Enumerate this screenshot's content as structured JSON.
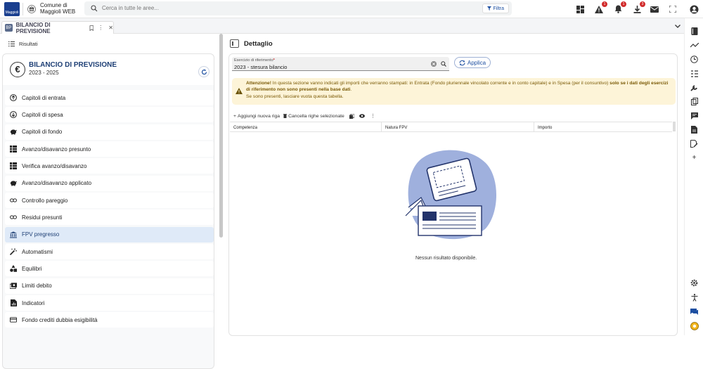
{
  "topbar": {
    "logo_text": "Maggioli",
    "app_name_line1": "Comune di",
    "app_name_line2": "Maggioli WEB",
    "search_placeholder": "Cerca in tutte le aree...",
    "filter_label": "Filtra",
    "badges": [
      "1",
      "1",
      "3"
    ]
  },
  "tab": {
    "label": "BILANCIO DI PREVISIONE"
  },
  "left_panel": {
    "risultati_label": "Risultati",
    "card_title": "BILANCIO DI PREVISIONE",
    "card_years": "2023 - 2025",
    "menu": [
      {
        "label": "Capitoli di entrata",
        "icon": "arrow-up-circle-icon",
        "active": false
      },
      {
        "label": "Capitoli di spesa",
        "icon": "arrow-down-circle-icon",
        "active": false
      },
      {
        "label": "Capitoli di fondo",
        "icon": "piggy-bank-icon",
        "active": false
      },
      {
        "label": "Avanzo/disavanzo presunto",
        "icon": "table-icon",
        "active": false
      },
      {
        "label": "Verifica avanzo/disavanzo",
        "icon": "table-icon",
        "active": false
      },
      {
        "label": "Avanzo/disavanzo applicato",
        "icon": "piggy-bank-icon",
        "active": false
      },
      {
        "label": "Controllo pareggio",
        "icon": "link-icon",
        "active": false
      },
      {
        "label": "Residui presunti",
        "icon": "link-icon",
        "active": false
      },
      {
        "label": "FPV pregresso",
        "icon": "bank-icon",
        "active": true
      },
      {
        "label": "Automatismi",
        "icon": "magic-wand-icon",
        "active": false
      },
      {
        "label": "Equilibri",
        "icon": "shapes-icon",
        "active": false
      },
      {
        "label": "Limiti debito",
        "icon": "money-icon",
        "active": false
      },
      {
        "label": "Indicatori",
        "icon": "chart-icon",
        "active": false
      },
      {
        "label": "Fondo crediti dubbia esigibilità",
        "icon": "card-icon",
        "active": false
      }
    ]
  },
  "detail": {
    "title": "Dettaglio",
    "field_label": "Esercizio di riferimento",
    "field_required": "*",
    "field_value": "2023 - stesura bilancio",
    "apply_label": "Applica",
    "warning": {
      "prefix": "Attenzione!",
      "text_part1": " In questa sezione vanno indicati gli importi che verranno stampati: in Entrata (Fondo pluriennale vincolato corrente e in conto capitale) e in Spesa (per il consuntivo) ",
      "bold_part": "solo se i dati degli esercizi di riferimento non sono presenti nella base dati",
      "text_part2": ".",
      "line3": "Se sono presenti, lasciare vuota questa tabella."
    },
    "toolbar": {
      "add_label": "Aggiungi nuova riga",
      "delete_label": "Cancella righe selezionate"
    },
    "columns": [
      "Competenza",
      "Natura FPV",
      "Importo"
    ],
    "empty_text": "Nessun risultato disponibile."
  }
}
